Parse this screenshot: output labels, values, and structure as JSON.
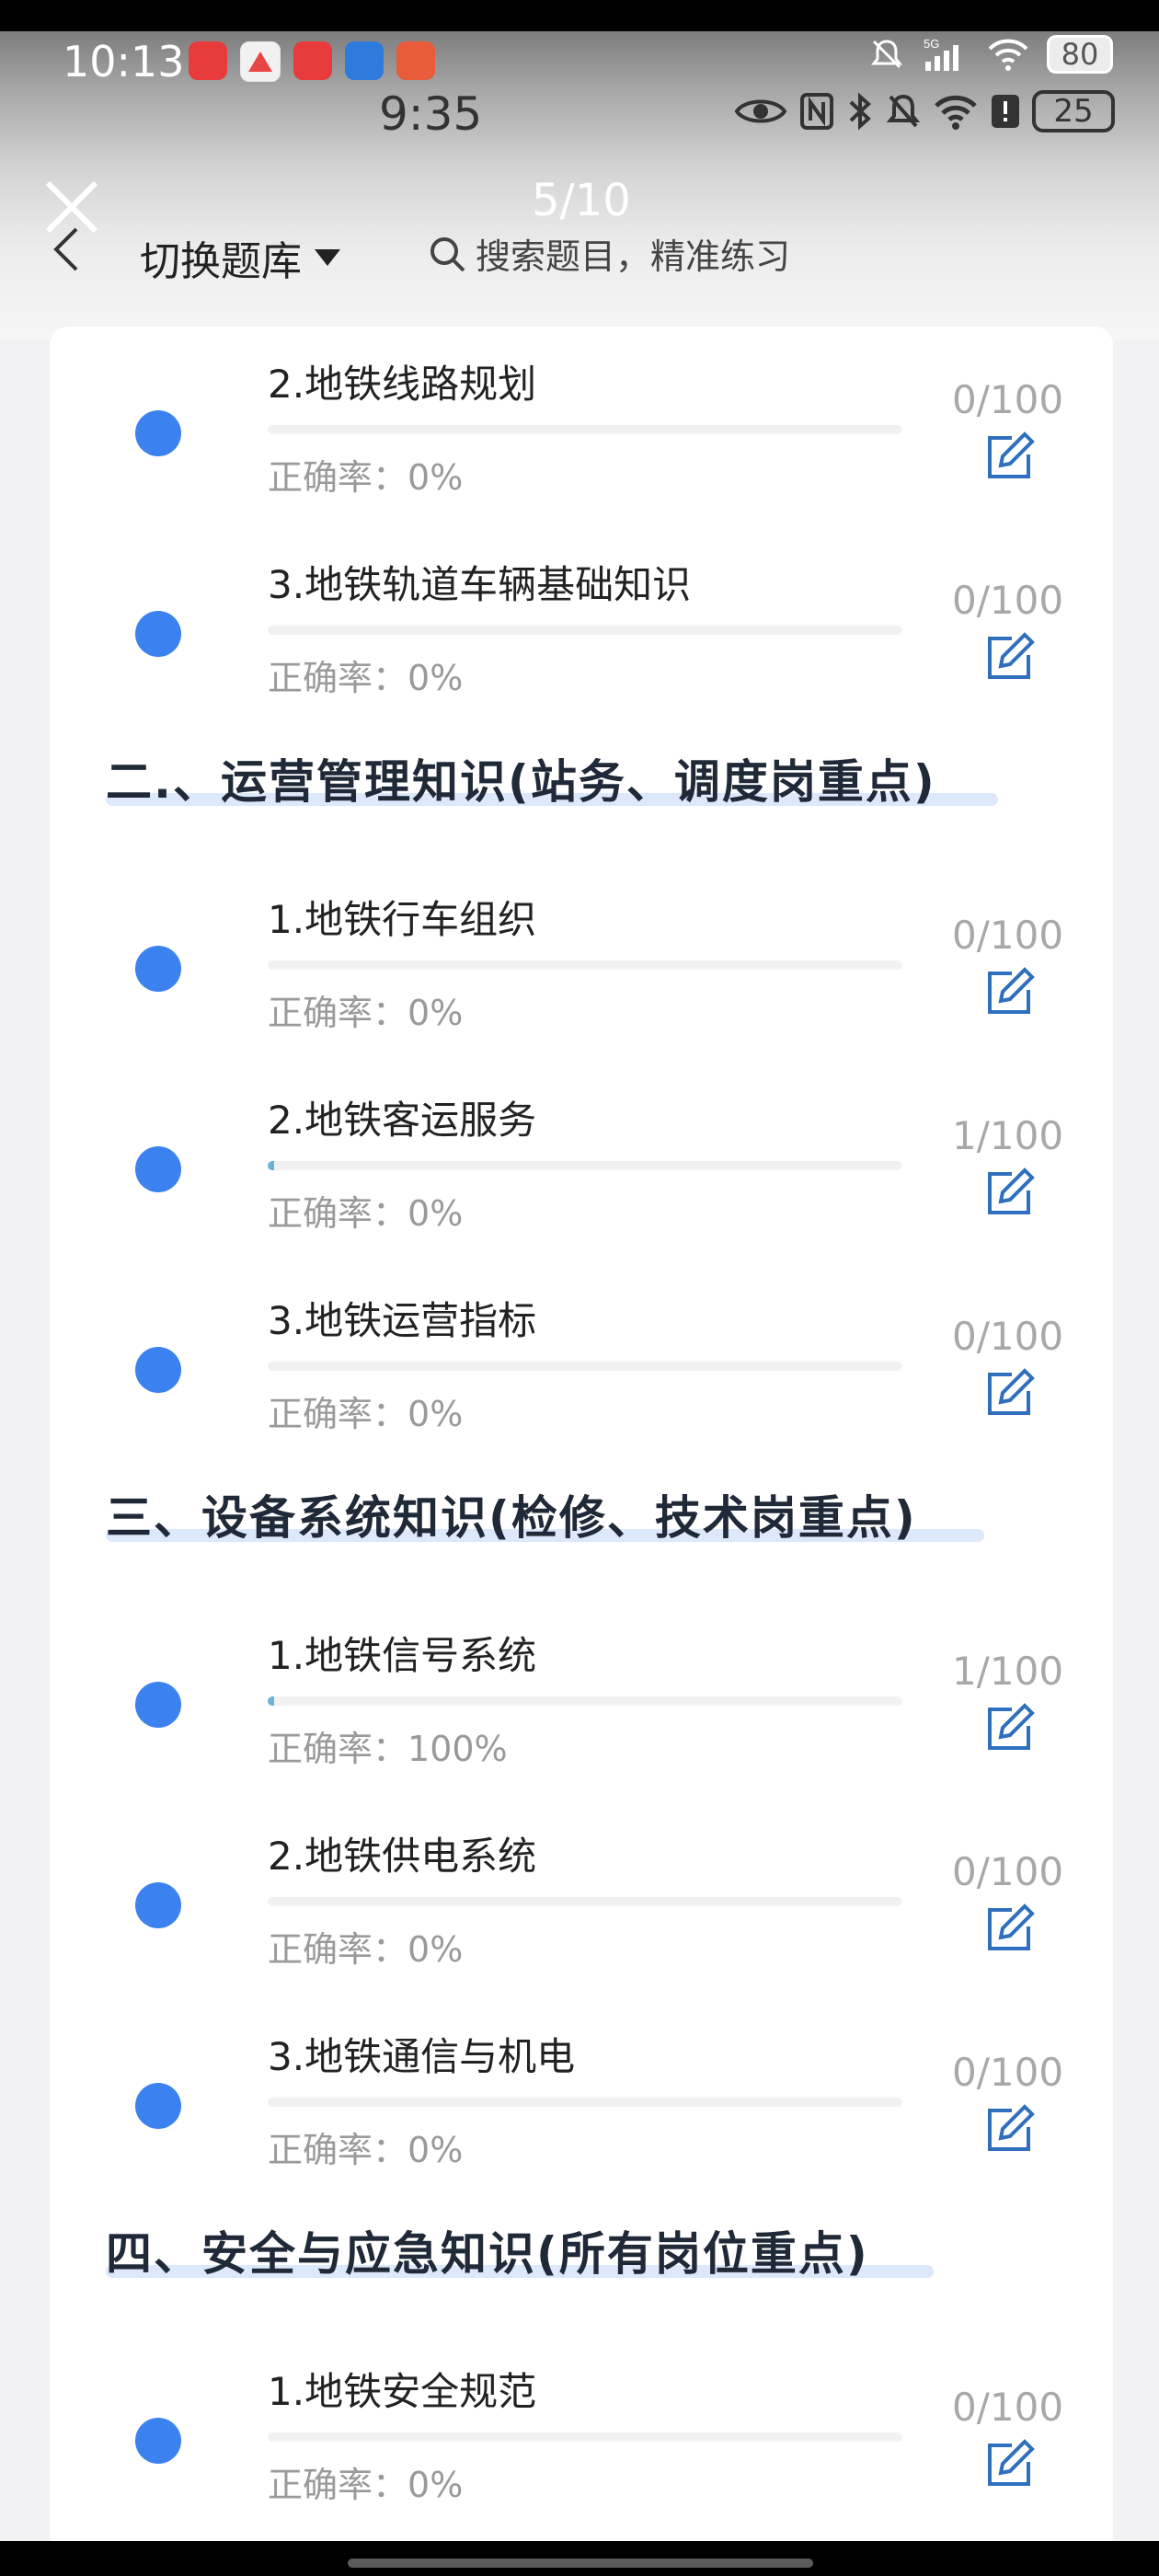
{
  "outer_status": {
    "time": "10:13",
    "network": "5G",
    "battery": "80"
  },
  "inner_status": {
    "time": "9:35",
    "battery": "25"
  },
  "viewer": {
    "counter": "5/10"
  },
  "header": {
    "switch_label": "切换题库",
    "search_placeholder": "搜索题目，精准练习"
  },
  "accuracy_label": "正确率：",
  "sections": [
    {
      "title": "二.、运营管理知识(站务、调度岗重点)"
    },
    {
      "title": "三、设备系统知识(检修、技术岗重点)"
    },
    {
      "title": "四、安全与应急知识(所有岗位重点)"
    }
  ],
  "items": [
    {
      "title": "2.地铁线路规划",
      "accuracy": "0%",
      "count": "0/100",
      "progress": 0
    },
    {
      "title": "3.地铁轨道车辆基础知识",
      "accuracy": "0%",
      "count": "0/100",
      "progress": 0
    },
    {
      "title": "1.地铁行车组织",
      "accuracy": "0%",
      "count": "0/100",
      "progress": 0
    },
    {
      "title": "2.地铁客运服务",
      "accuracy": "0%",
      "count": "1/100",
      "progress": 0.01
    },
    {
      "title": "3.地铁运营指标",
      "accuracy": "0%",
      "count": "0/100",
      "progress": 0
    },
    {
      "title": "1.地铁信号系统",
      "accuracy": "100%",
      "count": "1/100",
      "progress": 0.01
    },
    {
      "title": "2.地铁供电系统",
      "accuracy": "0%",
      "count": "0/100",
      "progress": 0
    },
    {
      "title": "3.地铁通信与机电",
      "accuracy": "0%",
      "count": "0/100",
      "progress": 0
    },
    {
      "title": "1.地铁安全规范",
      "accuracy": "0%",
      "count": "0/100",
      "progress": 0
    }
  ],
  "colors": {
    "dot": "#3b82f0",
    "edit_icon": "#2f6fbd",
    "progress_fill": "#6db1d6",
    "section_highlight": "#dde9fb"
  },
  "icons": [
    "close-icon",
    "back-chevron-icon",
    "caret-down-icon",
    "search-icon",
    "edit-icon",
    "eye-icon",
    "nfc-icon",
    "bluetooth-icon",
    "mute-bell-icon",
    "wifi-icon",
    "signal-icon"
  ]
}
